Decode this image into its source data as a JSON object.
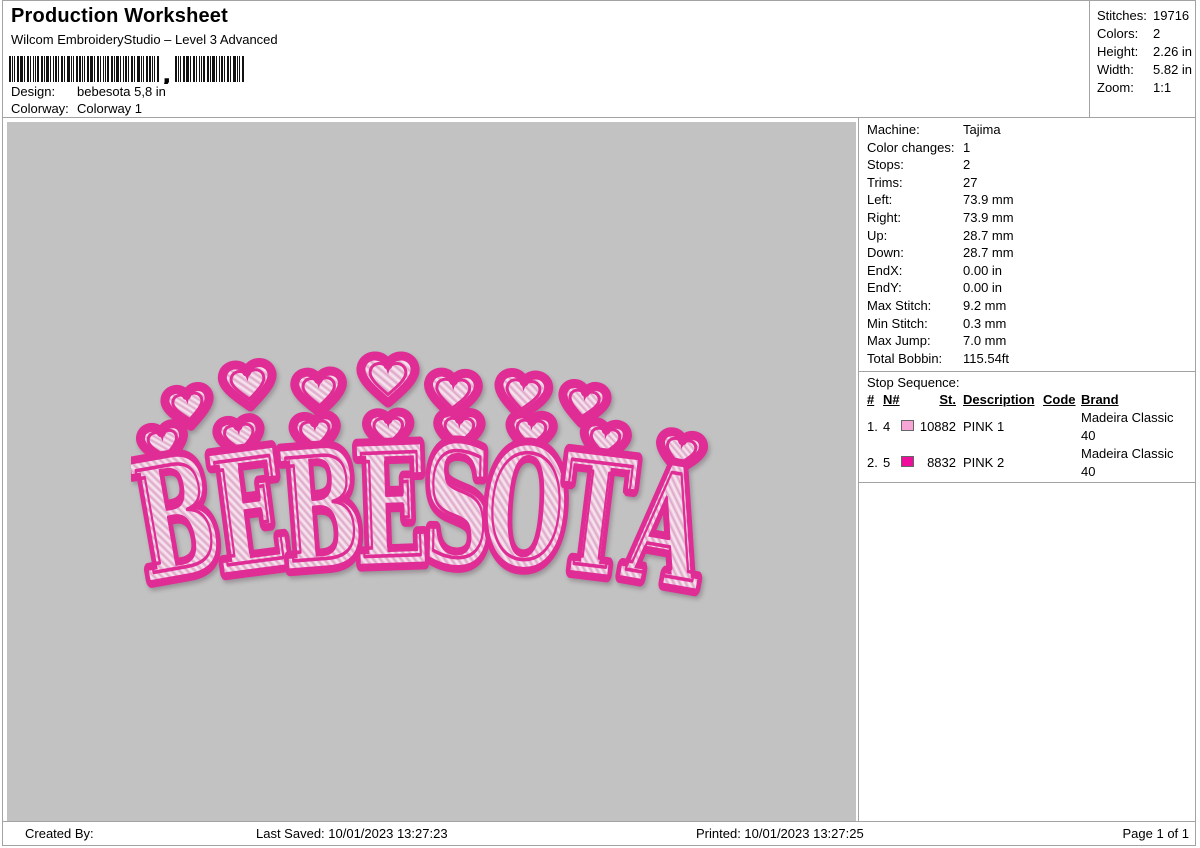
{
  "header": {
    "title": "Production Worksheet",
    "subtitle": "Wilcom EmbroideryStudio – Level 3 Advanced",
    "barcode_separator": ",",
    "design_label": "Design:",
    "design_value": "bebesota 5,8 in",
    "colorway_label": "Colorway:",
    "colorway_value": "Colorway 1"
  },
  "stats_box": {
    "rows": [
      {
        "label": "Stitches:",
        "value": "19716"
      },
      {
        "label": "Colors:",
        "value": "2"
      },
      {
        "label": "Height:",
        "value": "2.26 in"
      },
      {
        "label": "Width:",
        "value": "5.82 in"
      },
      {
        "label": "Zoom:",
        "value": "1:1"
      }
    ]
  },
  "machine_panel": {
    "rows": [
      {
        "label": "Machine:",
        "value": "Tajima"
      },
      {
        "label": "Color changes:",
        "value": "1"
      },
      {
        "label": "Stops:",
        "value": "2"
      },
      {
        "label": "Trims:",
        "value": "27"
      },
      {
        "label": "Left:",
        "value": "73.9 mm"
      },
      {
        "label": "Right:",
        "value": "73.9 mm"
      },
      {
        "label": "Up:",
        "value": "28.7 mm"
      },
      {
        "label": "Down:",
        "value": "28.7 mm"
      },
      {
        "label": "EndX:",
        "value": "0.00 in"
      },
      {
        "label": "EndY:",
        "value": "0.00 in"
      },
      {
        "label": "Max Stitch:",
        "value": "9.2 mm"
      },
      {
        "label": "Min Stitch:",
        "value": "0.3 mm"
      },
      {
        "label": "Max Jump:",
        "value": "7.0 mm"
      },
      {
        "label": "Total Bobbin:",
        "value": "115.54ft"
      }
    ]
  },
  "stop_sequence": {
    "title": "Stop Sequence:",
    "columns": {
      "num": "#",
      "n": "N#",
      "st": "St.",
      "description": "Description",
      "code": "Code",
      "brand": "Brand"
    },
    "rows": [
      {
        "num": "1.",
        "n": "4",
        "swatch_color": "#f7a4d7",
        "st": "10882",
        "description": "PINK 1",
        "code": "",
        "brand": "Madeira Classic 40"
      },
      {
        "num": "2.",
        "n": "5",
        "swatch_color": "#ef0d9b",
        "st": "8832",
        "description": "PINK 2",
        "code": "",
        "brand": "Madeira Classic 40"
      }
    ]
  },
  "design": {
    "word": "BEBESOTA",
    "outline_color": "#df2d95",
    "fill_base": "#ecc7db",
    "fill_light": "#f7e4ef",
    "fill_dark": "#dda8ca",
    "canvas_color": "#c2c2c2"
  },
  "footer": {
    "created_by": "Created By:",
    "last_saved": "Last Saved: 10/01/2023 13:27:23",
    "printed": "Printed: 10/01/2023 13:27:25",
    "page": "Page 1 of 1"
  }
}
